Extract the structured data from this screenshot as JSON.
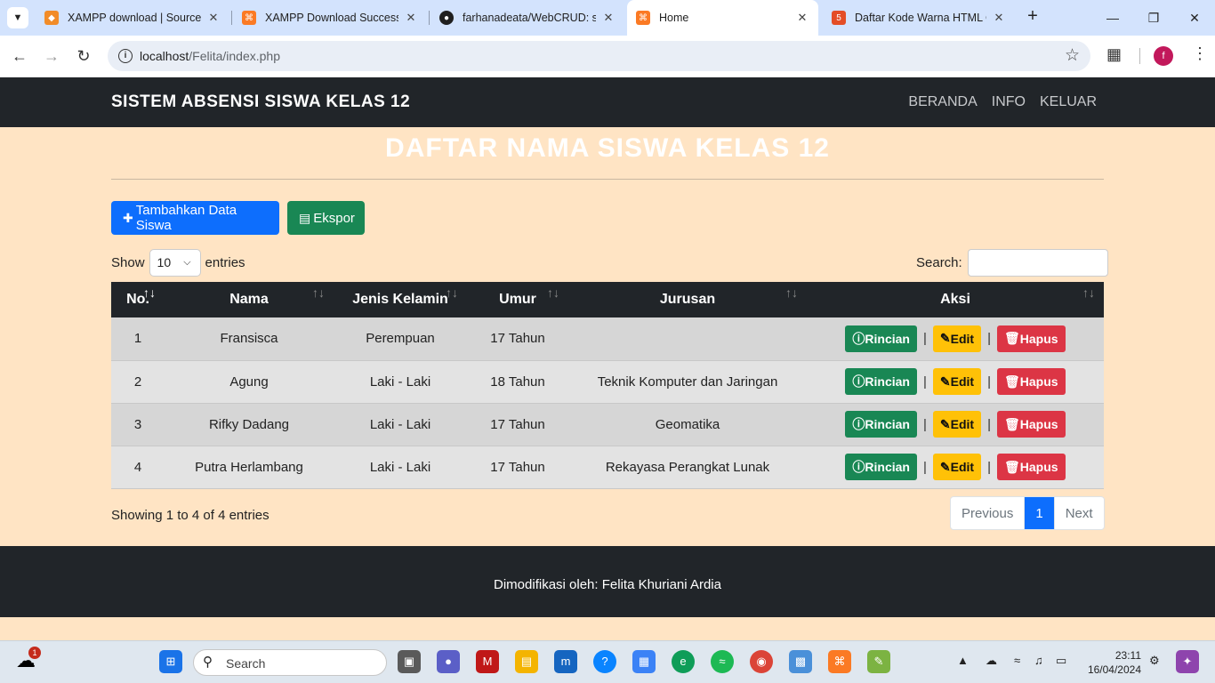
{
  "browser": {
    "tabs": [
      {
        "title": "XAMPP download | SourceF",
        "icon_color": "#f28c28"
      },
      {
        "title": "XAMPP Download Success",
        "icon_color": "#fb7a24"
      },
      {
        "title": "farhanadeata/WebCRUD: sil",
        "icon_color": "#1f1f1f"
      },
      {
        "title": "Home",
        "icon_color": "#fb7a24",
        "active": true
      },
      {
        "title": "Daftar Kode Warna HTML C",
        "icon_color": "#e44d26"
      }
    ],
    "url_host": "localhost",
    "url_path": "/Felita/index.php",
    "profile_initial": "f"
  },
  "navbar": {
    "brand": "SISTEM ABSENSI SISWA KELAS 12",
    "links": [
      "BERANDA",
      "INFO",
      "KELUAR"
    ]
  },
  "page": {
    "heading": "DAFTAR NAMA SISWA KELAS 12",
    "add_button": "Tambahkan Data Siswa",
    "export_button": "Ekspor",
    "show_label": "Show",
    "entries_value": "10",
    "entries_label": "entries",
    "search_label": "Search:",
    "columns": [
      "No.",
      "Nama",
      "Jenis Kelamin",
      "Umur",
      "Jurusan",
      "Aksi"
    ],
    "rows": [
      {
        "no": "1",
        "nama": "Fransisca",
        "jk": "Perempuan",
        "umur": "17 Tahun",
        "jurusan": ""
      },
      {
        "no": "2",
        "nama": "Agung",
        "jk": "Laki - Laki",
        "umur": "18 Tahun",
        "jurusan": "Teknik Komputer dan Jaringan"
      },
      {
        "no": "3",
        "nama": "Rifky Dadang",
        "jk": "Laki - Laki",
        "umur": "17 Tahun",
        "jurusan": "Geomatika"
      },
      {
        "no": "4",
        "nama": "Putra Herlambang",
        "jk": "Laki - Laki",
        "umur": "17 Tahun",
        "jurusan": "Rekayasa Perangkat Lunak"
      }
    ],
    "actions": {
      "detail": "Rincian",
      "edit": "Edit",
      "delete": "Hapus",
      "separator": "|"
    },
    "info": "Showing 1 to 4 of 4 entries",
    "pager": {
      "prev": "Previous",
      "current": "1",
      "next": "Next"
    },
    "footer": "Dimodifikasi oleh: Felita Khuriani Ardia"
  },
  "taskbar": {
    "search_placeholder": "Search",
    "weather_badge": "1",
    "time": "23:11",
    "date": "16/04/2024"
  }
}
